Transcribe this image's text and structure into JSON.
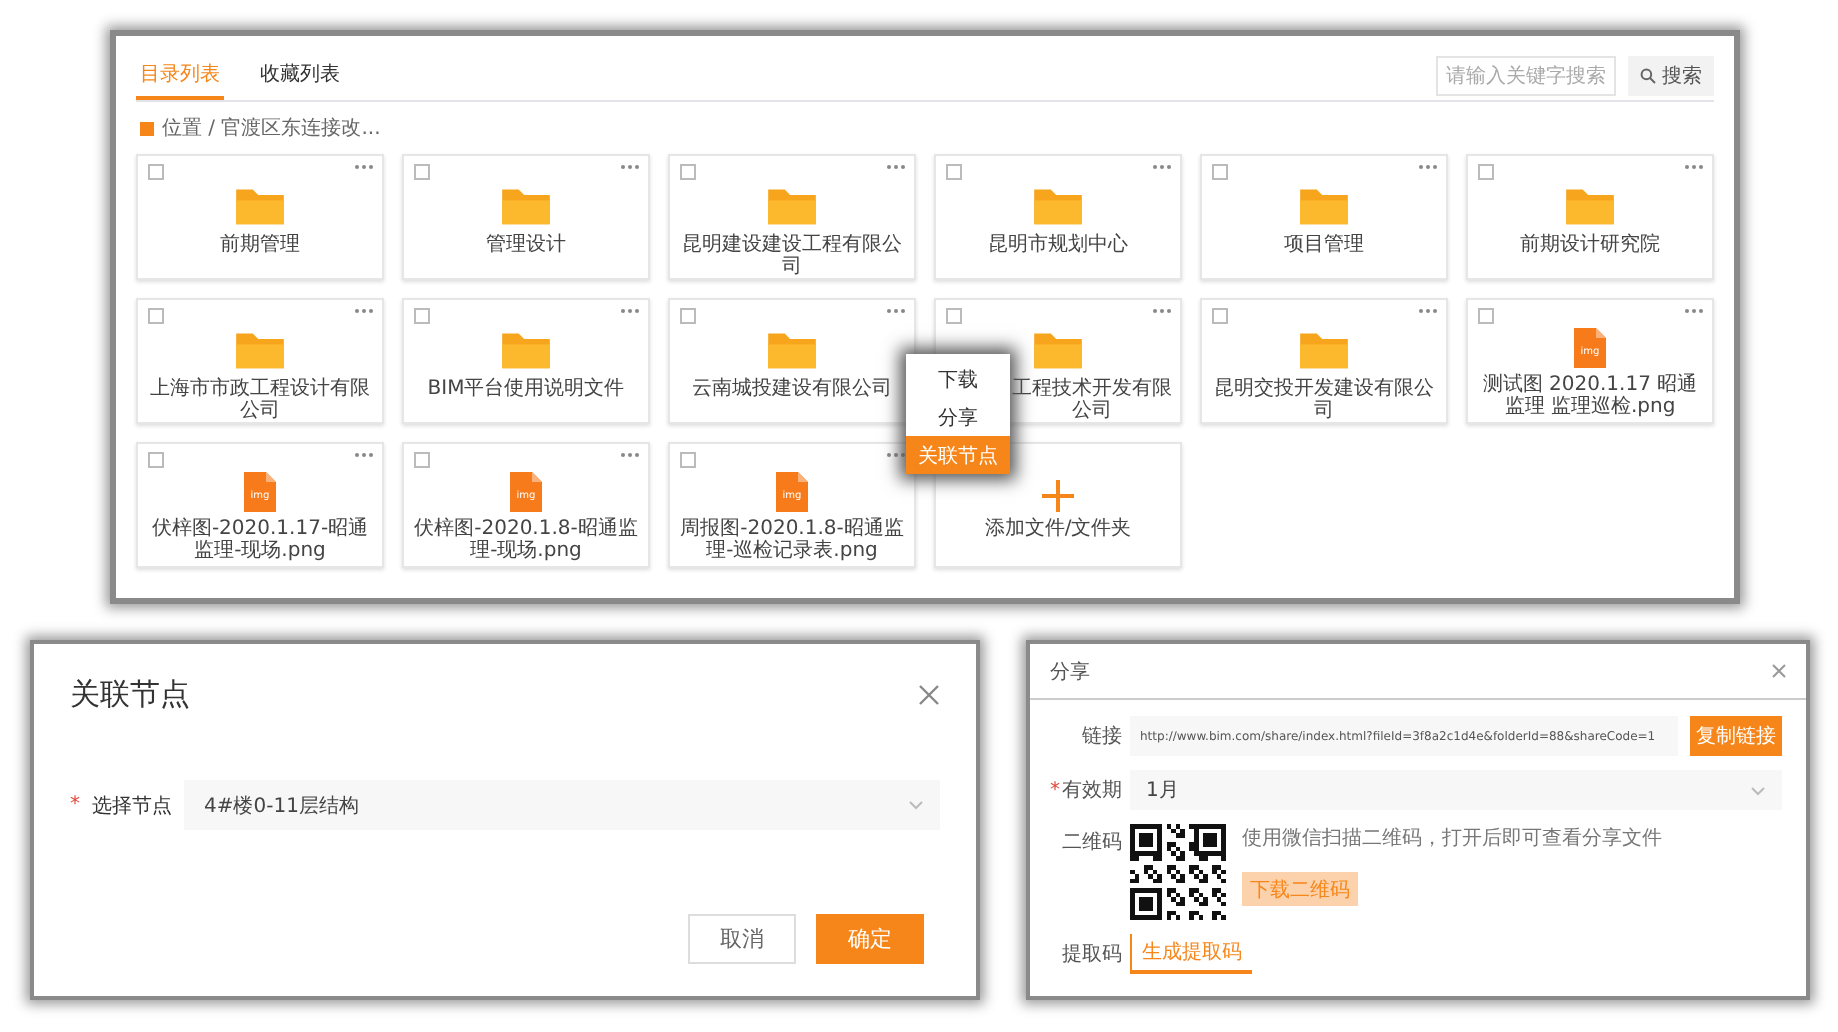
{
  "explorer": {
    "tabs": [
      {
        "label": "目录列表",
        "selected": true
      },
      {
        "label": "收藏列表",
        "selected": false
      }
    ],
    "search": {
      "placeholder": "请输入关键字搜索",
      "button": "搜索"
    },
    "breadcrumb": "位置 / 官渡区东连接改...",
    "items": [
      {
        "kind": "folder",
        "name": "前期管理",
        "menu_open": false,
        "checked": false
      },
      {
        "kind": "folder",
        "name": "管理设计",
        "menu_open": false,
        "checked": false
      },
      {
        "kind": "folder",
        "name": "昆明建设建设工程有限公司",
        "menu_open": false,
        "checked": false
      },
      {
        "kind": "folder",
        "name": "昆明市规划中心",
        "menu_open": false,
        "checked": false
      },
      {
        "kind": "folder",
        "name": "项目管理",
        "menu_open": false,
        "checked": false
      },
      {
        "kind": "folder",
        "name": "前期设计研究院",
        "menu_open": false,
        "checked": false
      },
      {
        "kind": "folder",
        "name": "上海市市政工程设计有限公司",
        "menu_open": false,
        "checked": false
      },
      {
        "kind": "folder",
        "name": "BIM平台使用说明文件",
        "menu_open": false,
        "checked": false
      },
      {
        "kind": "folder",
        "name": "云南城投建设有限公司",
        "menu_open": false,
        "checked": false
      },
      {
        "kind": "folder",
        "name": "工程技术开发有限公司",
        "menu_open": true,
        "checked": false
      },
      {
        "kind": "folder",
        "name": "昆明交投开发建设有限公司",
        "menu_open": false,
        "checked": false
      },
      {
        "kind": "image",
        "badge": "img",
        "name": "测试图 2020.1.17 昭通监理 监理巡检.png",
        "menu_open": false,
        "checked": false
      },
      {
        "kind": "image",
        "badge": "img",
        "name": "伏梓图-2020.1.17-昭通监理-现场.png",
        "menu_open": false,
        "checked": false
      },
      {
        "kind": "image",
        "badge": "img",
        "name": "伏梓图-2020.1.8-昭通监理-现场.png",
        "menu_open": false,
        "checked": false
      },
      {
        "kind": "image",
        "badge": "img",
        "name": "周报图-2020.1.8-昭通监理-巡检记录表.png",
        "menu_open": false,
        "checked": false
      },
      {
        "kind": "add",
        "name": "添加文件/文件夹",
        "menu_open": false
      }
    ],
    "context_menu": [
      {
        "label": "下载",
        "selected": false
      },
      {
        "label": "分享",
        "selected": false
      },
      {
        "label": "关联节点",
        "selected": true
      }
    ]
  },
  "link_dialog": {
    "title": "关联节点",
    "field_mark": "*",
    "field_label": "选择节点",
    "value": "4#楼0-11层结构",
    "buttons": [
      {
        "label": "取消",
        "kind": "default"
      },
      {
        "label": "确定",
        "kind": "primary"
      }
    ]
  },
  "share_dialog": {
    "title": "分享",
    "link_label": "链接",
    "link": "http://www.bim.com/share/index.html?fileId=3f8a2c1d4e&folderId=88&shareCode=1",
    "copy_button": "复制链接",
    "validity_mark": "*",
    "validity_label": "有效期",
    "validity": "1月",
    "qr_label": "二维码",
    "qr_hint": "使用微信扫描二维码，打开后即可查看分享文件",
    "qr_button": "下载二维码",
    "code_label": "提取码",
    "code_tab": "生成提取码"
  }
}
